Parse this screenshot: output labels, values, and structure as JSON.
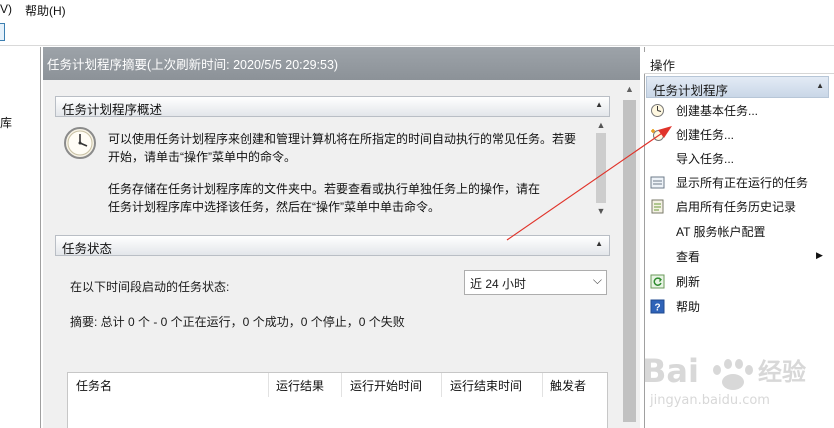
{
  "menu": {
    "item_view_partial": "V)",
    "item_help": "帮助(H)"
  },
  "left_tree": {
    "partial_label": "库"
  },
  "center": {
    "header_title": "任务计划程序摘要(上次刷新时间: 2020/5/5 20:29:53)",
    "overview": {
      "title": "任务计划程序概述",
      "line1": "可以使用任务计划程序来创建和管理计算机将在所指定的时间自动执行的常见任务。若要",
      "line2": "开始，请单击“操作”菜单中的命令。",
      "line3": "任务存储在任务计划程序库的文件夹中。若要查看或执行单独任务上的操作，请在",
      "line4": "任务计划程序库中选择该任务，然后在“操作”菜单中单击命令。"
    },
    "status": {
      "title": "任务状态",
      "period_label": "在以下时间段启动的任务状态:",
      "period_value": "近 24 小时",
      "summary": "摘要: 总计 0 个 - 0 个正在运行，0 个成功，0 个停止，0 个失败"
    },
    "table": {
      "columns": [
        "任务名",
        "运行结果",
        "运行开始时间",
        "运行结束时间",
        "触发者"
      ]
    }
  },
  "actions": {
    "title": "操作",
    "group": "任务计划程序",
    "items": [
      {
        "label": "创建基本任务...",
        "icon": "basic-task-wizard-icon"
      },
      {
        "label": "创建任务...",
        "icon": "create-task-icon"
      },
      {
        "label": "导入任务...",
        "icon": ""
      },
      {
        "label": "显示所有正在运行的任务",
        "icon": "running-tasks-icon"
      },
      {
        "label": "启用所有任务历史记录",
        "icon": "history-icon"
      },
      {
        "label": "AT 服务帐户配置",
        "icon": ""
      },
      {
        "label": "查看",
        "icon": ""
      },
      {
        "label": "刷新",
        "icon": "refresh-icon"
      },
      {
        "label": "帮助",
        "icon": "help-icon"
      }
    ]
  },
  "watermark": {
    "brand": "Bai度经验",
    "url": "jingyan.baidu.com"
  },
  "colors": {
    "annotation_arrow": "#e0332a",
    "group_header": "#c9d7e7",
    "summary_header": "#8c9298"
  }
}
